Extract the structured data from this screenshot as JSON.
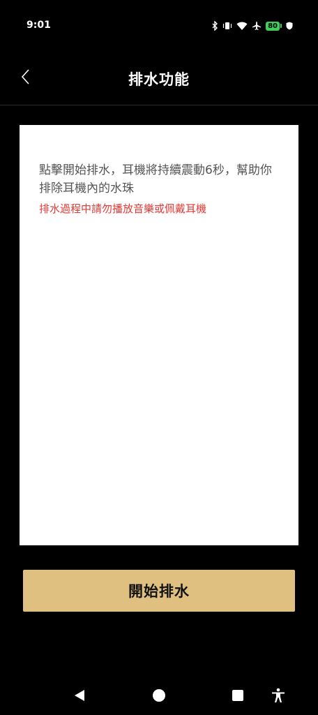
{
  "status_bar": {
    "time": "9:01",
    "icons": [
      "bluetooth-icon",
      "vibrate-icon",
      "wifi-icon",
      "airplane-icon",
      "battery-icon",
      "shield-icon"
    ],
    "battery_level": "80",
    "battery_color": "#3ecf5a"
  },
  "header": {
    "back_icon": "chevron-left-icon",
    "title": "排水功能"
  },
  "card": {
    "description": "點擊開始排水，耳機將持續震動6秒，幫助你排除耳機內的水珠",
    "warning": "排水過程中請勿播放音樂或佩戴耳機",
    "warning_color": "#e53935"
  },
  "start_button": {
    "label": "開始排水",
    "color": "#e0c080"
  },
  "nav_bar": {
    "items": [
      "back-triangle-icon",
      "home-circle-icon",
      "recents-square-icon",
      "accessibility-icon"
    ]
  }
}
